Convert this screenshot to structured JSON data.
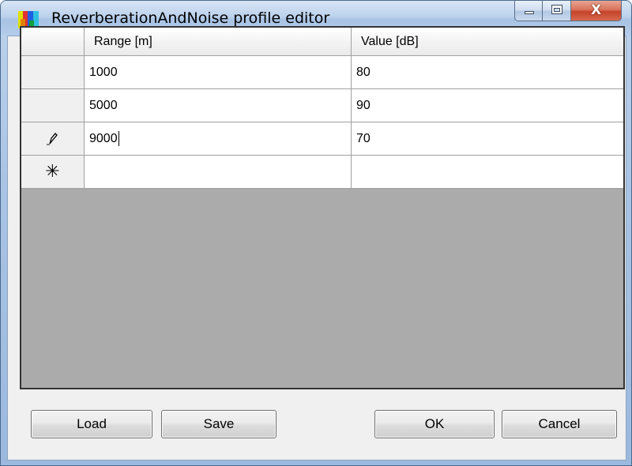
{
  "window": {
    "title": "ReverberationAndNoise profile editor",
    "close_glyph": "X"
  },
  "grid": {
    "columns": [
      "Range [m]",
      "Value [dB]"
    ],
    "rows": [
      {
        "range": "1000",
        "value": "80",
        "indicator": ""
      },
      {
        "range": "5000",
        "value": "90",
        "indicator": ""
      },
      {
        "range": "9000",
        "value": "70",
        "indicator": "pencil-icon"
      }
    ],
    "new_row_indicator": "asterisk-icon"
  },
  "buttons": {
    "load": "Load",
    "save": "Save",
    "ok": "OK",
    "cancel": "Cancel"
  },
  "colors": {
    "grid_empty_area": "#ababab",
    "close_button": "#c5432a"
  }
}
